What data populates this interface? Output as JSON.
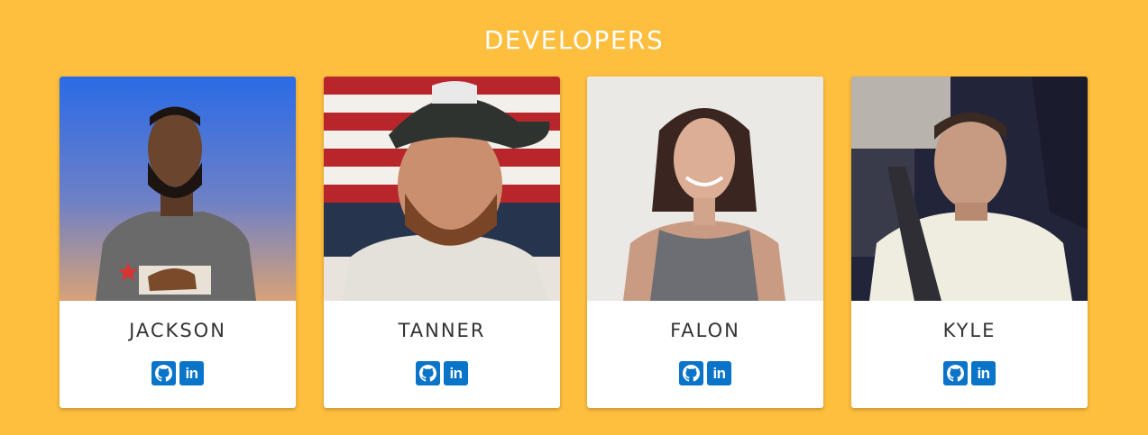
{
  "page": {
    "title": "DEVELOPERS"
  },
  "developers": [
    {
      "name": "JACKSON",
      "github_icon": "github-icon",
      "linkedin_icon": "linkedin-icon",
      "linkedin_text": "in"
    },
    {
      "name": "TANNER",
      "github_icon": "github-icon",
      "linkedin_icon": "linkedin-icon",
      "linkedin_text": "in"
    },
    {
      "name": "FALON",
      "github_icon": "github-icon",
      "linkedin_icon": "linkedin-icon",
      "linkedin_text": "in"
    },
    {
      "name": "KYLE",
      "github_icon": "github-icon",
      "linkedin_icon": "linkedin-icon",
      "linkedin_text": "in"
    }
  ],
  "colors": {
    "background": "#FEBE3E",
    "card": "#ffffff",
    "icon_accent": "#0A74C9",
    "heading_text": "#ffffff",
    "name_text": "#333333"
  }
}
